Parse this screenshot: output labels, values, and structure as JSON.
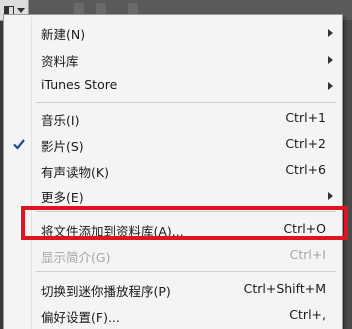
{
  "menu": {
    "items": [
      {
        "label": "新建(N)",
        "shortcut": "",
        "submenu": true
      },
      {
        "label": "资料库",
        "shortcut": "",
        "submenu": true
      },
      {
        "label": "iTunes Store",
        "shortcut": "",
        "submenu": true
      },
      {
        "label": "音乐(I)",
        "shortcut": "Ctrl+1"
      },
      {
        "label": "影片(S)",
        "shortcut": "Ctrl+2",
        "checked": true
      },
      {
        "label": "有声读物(K)",
        "shortcut": "Ctrl+6"
      },
      {
        "label": "更多(E)",
        "shortcut": "",
        "submenu": true
      },
      {
        "label": "将文件添加到资料库(A)...",
        "shortcut": "Ctrl+O",
        "highlighted": true
      },
      {
        "label": "显示简介(G)",
        "shortcut": "Ctrl+I",
        "disabled": true
      },
      {
        "label": "切换到迷你播放程序(P)",
        "shortcut": "Ctrl+Shift+M"
      },
      {
        "label": "偏好设置(F)...",
        "shortcut": "Ctrl+,"
      }
    ]
  },
  "colors": {
    "highlight_border": "#e0141e",
    "menu_background": "#f4f4f4",
    "disabled_text": "#a5a5a5"
  },
  "icons": {
    "menu_button": "window-menu-icon",
    "check": "check-icon"
  }
}
